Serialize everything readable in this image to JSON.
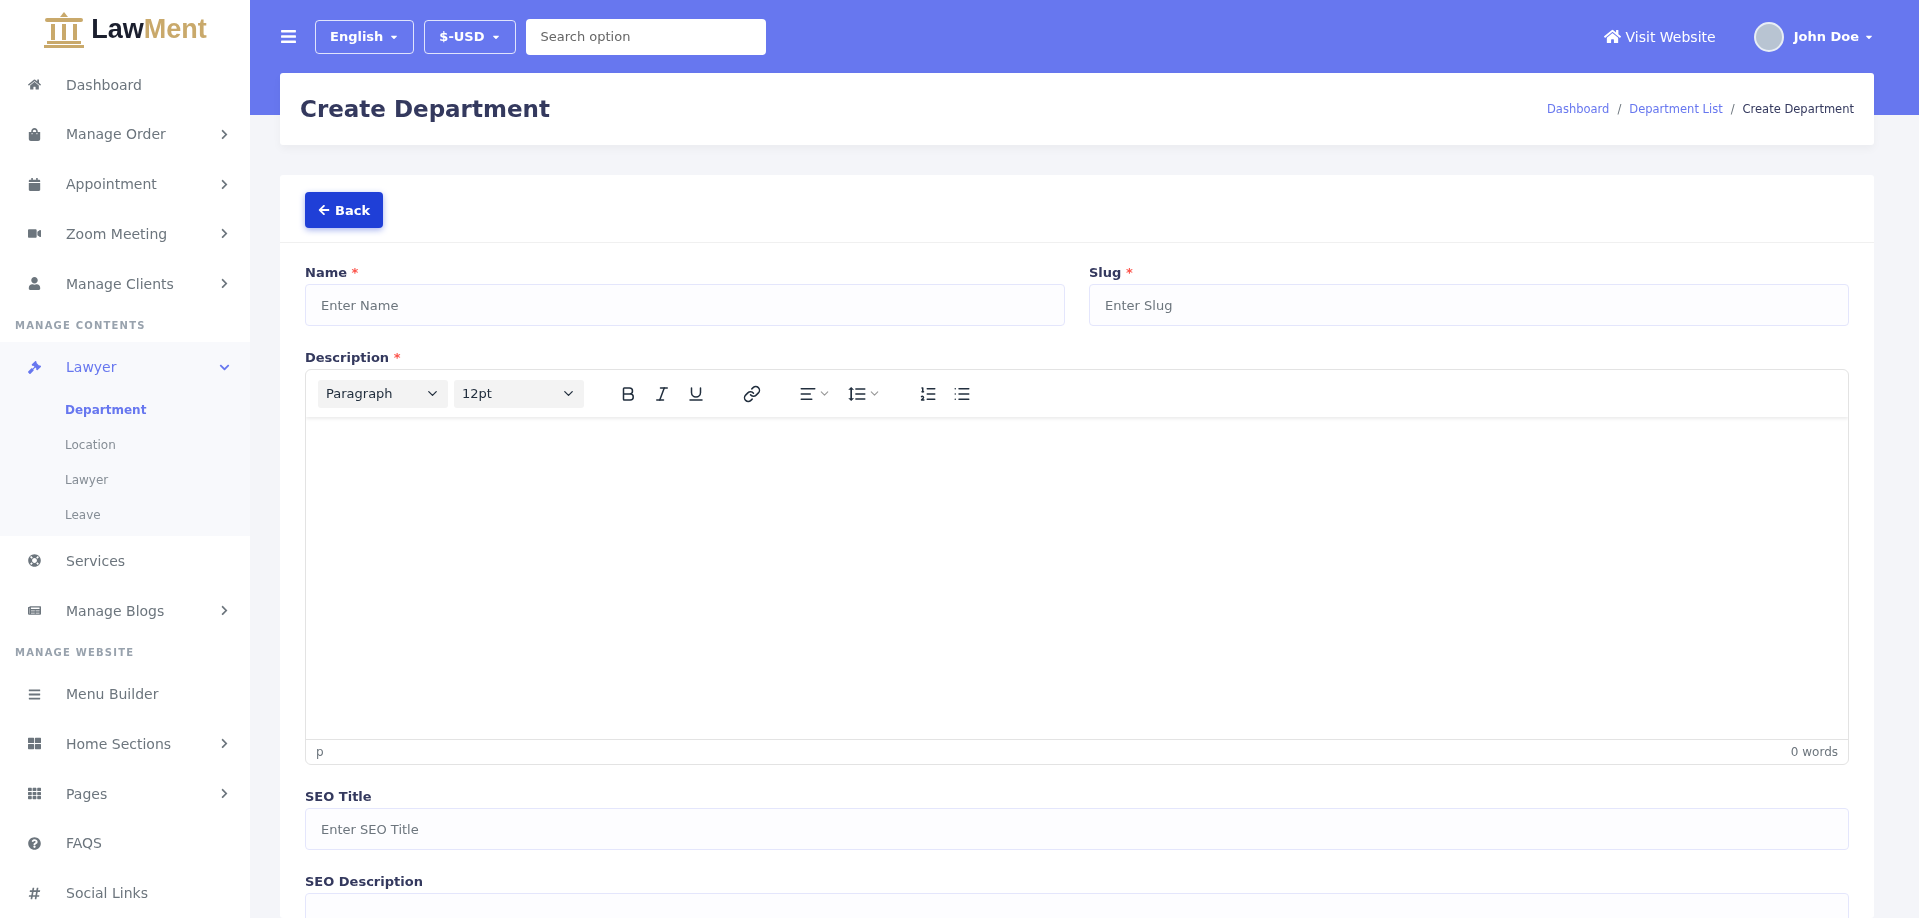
{
  "sidebar": {
    "brand": {
      "first": "Law",
      "second": "Ment"
    },
    "items": [
      {
        "kind": "link",
        "label": "Dashboard",
        "selected": false
      },
      {
        "kind": "menu",
        "label": "Manage Order",
        "selected": false,
        "expanded": false
      },
      {
        "kind": "menu",
        "label": "Appointment",
        "selected": false,
        "expanded": false
      },
      {
        "kind": "menu",
        "label": "Zoom Meeting",
        "selected": false,
        "expanded": false
      },
      {
        "kind": "menu",
        "label": "Manage Clients",
        "selected": false,
        "expanded": false
      },
      {
        "kind": "heading",
        "label": "MANAGE CONTENTS"
      },
      {
        "kind": "menu",
        "label": "Lawyer",
        "selected": true,
        "expanded": true,
        "children": [
          {
            "label": "Department",
            "selected": true
          },
          {
            "label": "Location",
            "selected": false
          },
          {
            "label": "Lawyer",
            "selected": false
          },
          {
            "label": "Leave",
            "selected": false
          }
        ]
      },
      {
        "kind": "link",
        "label": "Services",
        "selected": false
      },
      {
        "kind": "menu",
        "label": "Manage Blogs",
        "selected": false,
        "expanded": false
      },
      {
        "kind": "heading",
        "label": "MANAGE WEBSITE"
      },
      {
        "kind": "link",
        "label": "Menu Builder",
        "selected": false
      },
      {
        "kind": "menu",
        "label": "Home Sections",
        "selected": false,
        "expanded": false
      },
      {
        "kind": "menu",
        "label": "Pages",
        "selected": false,
        "expanded": false
      },
      {
        "kind": "link",
        "label": "FAQS",
        "selected": false
      },
      {
        "kind": "link",
        "label": "Social Links",
        "selected": false
      }
    ]
  },
  "topbar": {
    "language": "English",
    "currency": "$-USD",
    "search": {
      "placeholder": "Search option"
    },
    "visit": "Visit Website",
    "user": "John Doe"
  },
  "header": {
    "title": "Create Department",
    "breadcrumb": [
      {
        "label": "Dashboard",
        "link": true
      },
      {
        "separator": "/",
        "label": "Department List",
        "link": true
      },
      {
        "separator": "/",
        "label": "Create Department",
        "link": false
      }
    ]
  },
  "form": {
    "back": "Back",
    "row": [
      {
        "label": "Name",
        "required_mark": "*",
        "placeholder": "Enter Name"
      },
      {
        "label": "Slug",
        "required_mark": "*",
        "placeholder": "Enter Slug"
      }
    ],
    "editor": {
      "label": "Description",
      "required_mark": "*",
      "block": "Paragraph",
      "size": "12pt",
      "path": "p",
      "words": "0 words"
    },
    "fields": [
      {
        "label": "SEO Title",
        "placeholder": "Enter SEO Title"
      },
      {
        "label": "SEO Description"
      }
    ]
  }
}
